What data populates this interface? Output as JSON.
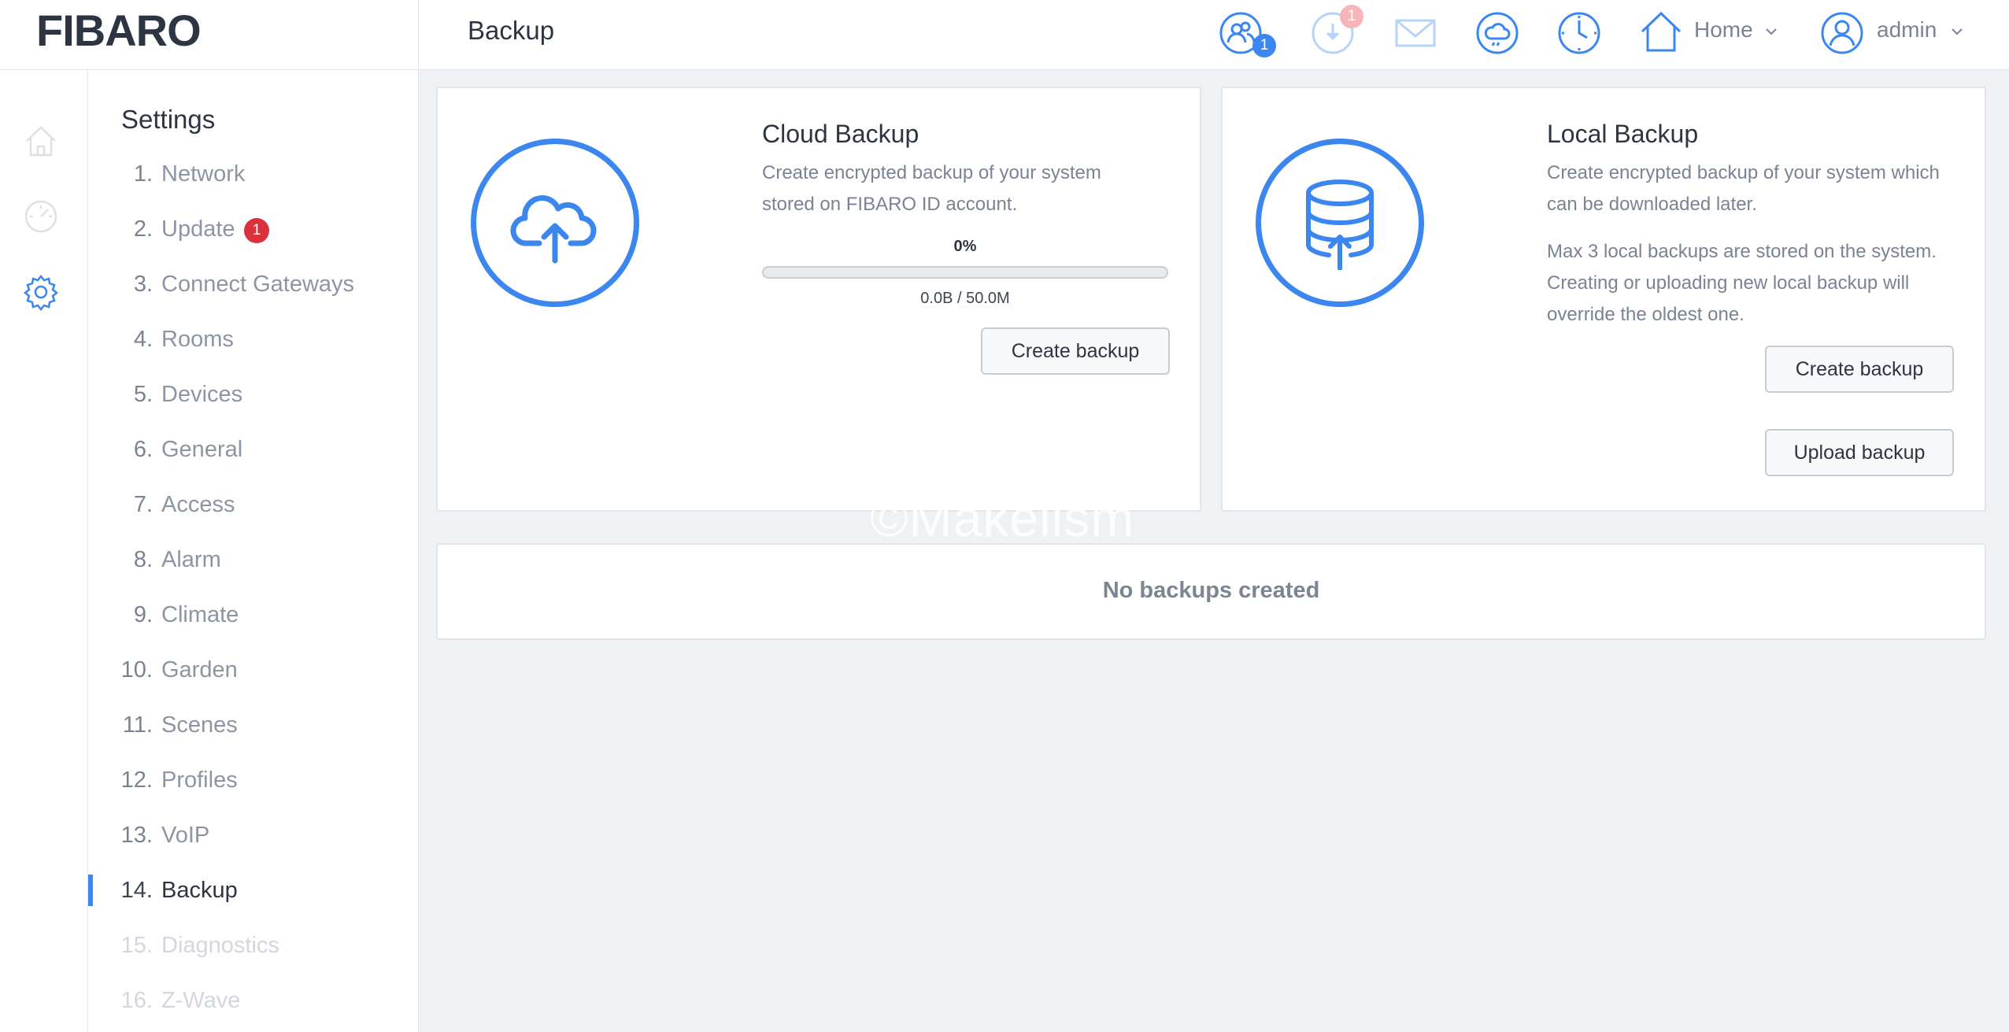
{
  "header": {
    "logo": "FIBARO",
    "page_title": "Backup",
    "users_badge": "1",
    "update_badge": "1",
    "home_label": "Home",
    "user_label": "admin"
  },
  "rail": {
    "icons": [
      "home-icon",
      "dashboard-gauge-icon",
      "gear-icon"
    ]
  },
  "settings": {
    "title": "Settings",
    "items": [
      {
        "num": "1.",
        "label": "Network"
      },
      {
        "num": "2.",
        "label": "Update",
        "badge": "1"
      },
      {
        "num": "3.",
        "label": "Connect Gateways"
      },
      {
        "num": "4.",
        "label": "Rooms"
      },
      {
        "num": "5.",
        "label": "Devices"
      },
      {
        "num": "6.",
        "label": "General"
      },
      {
        "num": "7.",
        "label": "Access"
      },
      {
        "num": "8.",
        "label": "Alarm"
      },
      {
        "num": "9.",
        "label": "Climate"
      },
      {
        "num": "10.",
        "label": "Garden"
      },
      {
        "num": "11.",
        "label": "Scenes"
      },
      {
        "num": "12.",
        "label": "Profiles"
      },
      {
        "num": "13.",
        "label": "VoIP"
      },
      {
        "num": "14.",
        "label": "Backup",
        "active": true
      },
      {
        "num": "15.",
        "label": "Diagnostics"
      },
      {
        "num": "16.",
        "label": "Z-Wave"
      }
    ]
  },
  "cloud": {
    "title": "Cloud Backup",
    "desc": "Create encrypted backup of your system stored on FIBARO ID account.",
    "progress_percent": 0,
    "progress_label": "0%",
    "progress_caption": "0.0B / 50.0M",
    "create_button": "Create backup"
  },
  "local": {
    "title": "Local Backup",
    "desc": "Create encrypted backup of your system which can be downloaded later.",
    "note": "Max 3 local backups are stored on the system. Creating or uploading new local backup will override the oldest one.",
    "create_button": "Create backup",
    "upload_button": "Upload backup"
  },
  "backups_list": {
    "empty_text": "No backups created"
  },
  "watermark": "©Makelism",
  "colors": {
    "accent": "#3c86ef",
    "badge_red": "#d9323d",
    "background": "#eff2f5"
  }
}
